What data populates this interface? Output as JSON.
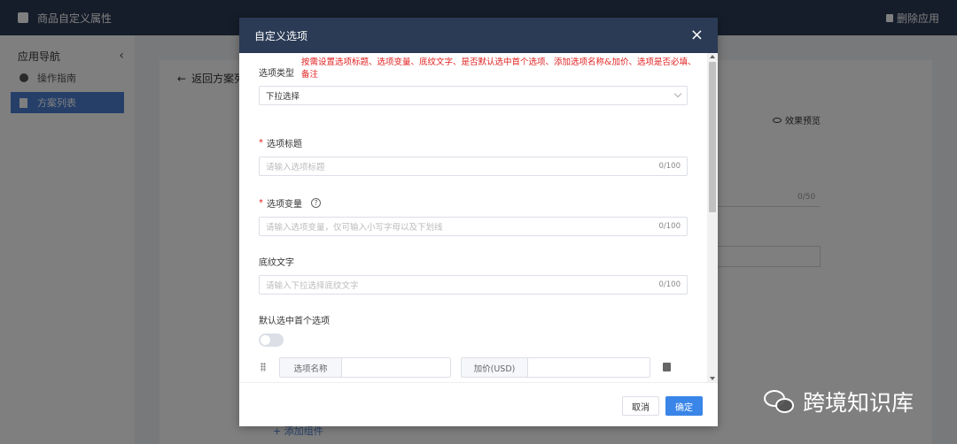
{
  "app": {
    "title": "商品自定义属性",
    "delete_app_label": "删除应用"
  },
  "sidebar": {
    "header": "应用导航",
    "items": [
      {
        "label": "操作指南",
        "icon": "guide-icon",
        "active": false
      },
      {
        "label": "方案列表",
        "icon": "document-icon",
        "active": true
      }
    ]
  },
  "content": {
    "back_label": "返回方案列",
    "preview_label": "效果预览",
    "counter": "0/50",
    "add_component_label": "+ 添加组件"
  },
  "modal": {
    "title": "自定义选项",
    "close_symbol": "×",
    "annotation": "按需设置选项标题、选项变量、底纹文字、是否默认选中首个选项、添加选项名称&加价、选项是否必填、备注",
    "option_type": {
      "label": "选项类型",
      "value": "下拉选择"
    },
    "option_title": {
      "label": "选项标题",
      "required": true,
      "placeholder": "请输入选项标题",
      "counter": "0/100"
    },
    "option_variable": {
      "label": "选项变量",
      "required": true,
      "help": "?",
      "placeholder": "请输入选项变量，仅可输入小写字母以及下划线",
      "counter": "0/100"
    },
    "shading_text": {
      "label": "底纹文字",
      "placeholder": "请输入下拉选择底纹文字",
      "counter": "0/100"
    },
    "default_first": {
      "label": "默认选中首个选项",
      "enabled": false
    },
    "option_row": {
      "name_prefix": "选项名称",
      "price_prefix": "加价(USD)"
    },
    "cancel_label": "取消",
    "confirm_label": "确定"
  },
  "watermark": {
    "text": "跨境知识库",
    "icon": "wechat-icon"
  },
  "colors": {
    "header_bg": "#2b3a55",
    "accent": "#3a85e8",
    "annotation_red": "#e02020"
  }
}
